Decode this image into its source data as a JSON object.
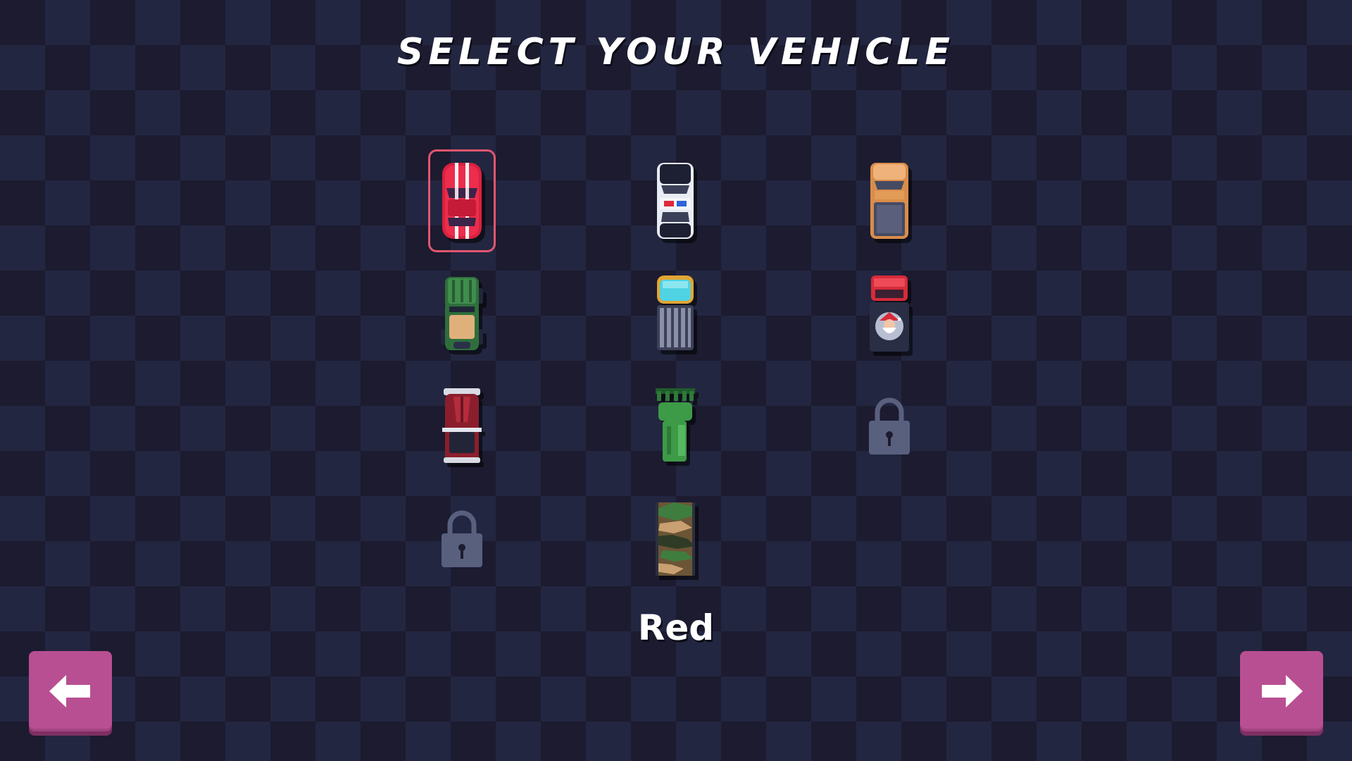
{
  "screen": {
    "title": "SELECT YOUR VEHICLE",
    "selected_vehicle_name": "Red"
  },
  "vehicles": [
    {
      "name": "Red",
      "icon": "red-sports-car-icon",
      "locked": false,
      "selected": true
    },
    {
      "name": "",
      "icon": "police-car-icon",
      "locked": false,
      "selected": false
    },
    {
      "name": "",
      "icon": "orange-pickup-truck-icon",
      "locked": false,
      "selected": false
    },
    {
      "name": "",
      "icon": "green-jeep-icon",
      "locked": false,
      "selected": false
    },
    {
      "name": "",
      "icon": "cyan-delivery-truck-icon",
      "locked": false,
      "selected": false
    },
    {
      "name": "",
      "icon": "santa-truck-icon",
      "locked": false,
      "selected": false
    },
    {
      "name": "",
      "icon": "dark-red-hotrod-icon",
      "locked": false,
      "selected": false
    },
    {
      "name": "",
      "icon": "green-tank-truck-icon",
      "locked": false,
      "selected": false
    },
    {
      "name": "",
      "icon": "lock-icon",
      "locked": true,
      "selected": false
    },
    {
      "name": "",
      "icon": "lock-icon",
      "locked": true,
      "selected": false
    },
    {
      "name": "",
      "icon": "camo-military-truck-icon",
      "locked": false,
      "selected": false
    }
  ],
  "navigation": {
    "back_icon": "arrow-left-icon",
    "next_icon": "arrow-right-icon"
  },
  "colors": {
    "background_dark": "#1c1b30",
    "background_light": "#232640",
    "selection_outline": "#e2566e",
    "button": "#b94f93",
    "lock": "#59607e"
  }
}
